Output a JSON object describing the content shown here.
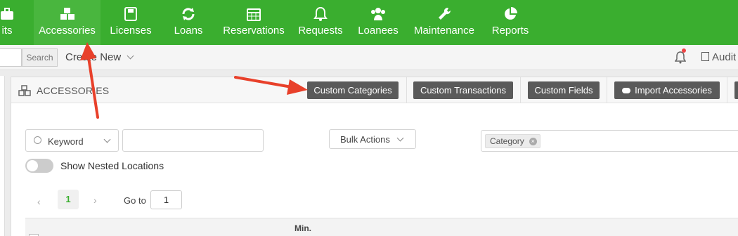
{
  "nav": {
    "items": [
      {
        "label": "its",
        "icon": "briefcase-icon"
      },
      {
        "label": "Accessories",
        "icon": "cubes-icon"
      },
      {
        "label": "Licenses",
        "icon": "floppy-disk-icon"
      },
      {
        "label": "Loans",
        "icon": "refresh-icon"
      },
      {
        "label": "Reservations",
        "icon": "calendar-icon"
      },
      {
        "label": "Requests",
        "icon": "bell-icon"
      },
      {
        "label": "Loanees",
        "icon": "users-icon"
      },
      {
        "label": "Maintenance",
        "icon": "wrench-icon"
      },
      {
        "label": "Reports",
        "icon": "pie-chart-icon"
      }
    ],
    "active": "Accessories",
    "color": "#3aae2f"
  },
  "subbar": {
    "search_label": "Search",
    "create_new_label": "Create New",
    "audit_label": "Audit"
  },
  "panel": {
    "title": "ACCESSORIES",
    "buttons": {
      "custom_categories": "Custom Categories",
      "custom_transactions": "Custom Transactions",
      "custom_fields": "Custom Fields",
      "import_accessories": "Import Accessories"
    }
  },
  "filters": {
    "keyword_label": "Keyword",
    "keyword_value": "",
    "bulk_actions_label": "Bulk Actions",
    "category_tag": "Category",
    "nested_locations_label": "Show Nested Locations"
  },
  "pagination": {
    "current_page": "1",
    "goto_label": "Go to",
    "goto_value": "1"
  },
  "table": {
    "partial_header": "Min."
  },
  "annotations": {
    "arrow_color": "#e8402a"
  }
}
